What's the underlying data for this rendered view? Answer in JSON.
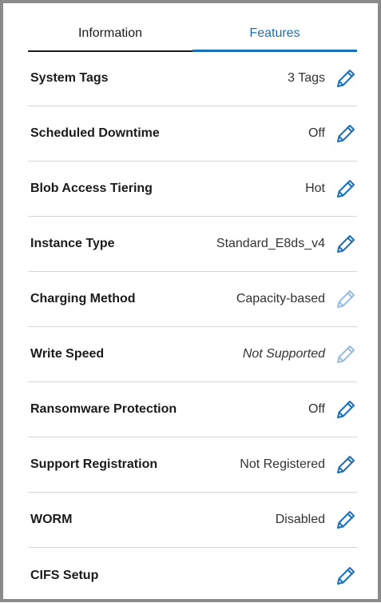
{
  "tabs": {
    "information": "Information",
    "features": "Features"
  },
  "colors": {
    "accent": "#1a6fbd",
    "text": "#1b1b1b",
    "divider": "#d6d6d6"
  },
  "rows": [
    {
      "label": "System Tags",
      "value": "3 Tags",
      "icon": "pencil-icon",
      "enabled": true
    },
    {
      "label": "Scheduled Downtime",
      "value": "Off",
      "icon": "pencil-icon",
      "enabled": true
    },
    {
      "label": "Blob Access Tiering",
      "value": "Hot",
      "icon": "pencil-icon",
      "enabled": true
    },
    {
      "label": "Instance Type",
      "value": "Standard_E8ds_v4",
      "icon": "pencil-icon",
      "enabled": true
    },
    {
      "label": "Charging Method",
      "value": "Capacity-based",
      "icon": "pencil-icon",
      "enabled": false
    },
    {
      "label": "Write Speed",
      "value": "Not Supported",
      "icon": "pencil-icon",
      "enabled": false
    },
    {
      "label": "Ransomware Protection",
      "value": "Off",
      "icon": "pencil-icon",
      "enabled": true
    },
    {
      "label": "Support Registration",
      "value": "Not Registered",
      "icon": "pencil-icon",
      "enabled": true
    },
    {
      "label": "WORM",
      "value": "Disabled",
      "icon": "pencil-icon",
      "enabled": true
    },
    {
      "label": "CIFS Setup",
      "value": "",
      "icon": "pencil-icon",
      "enabled": true
    }
  ]
}
